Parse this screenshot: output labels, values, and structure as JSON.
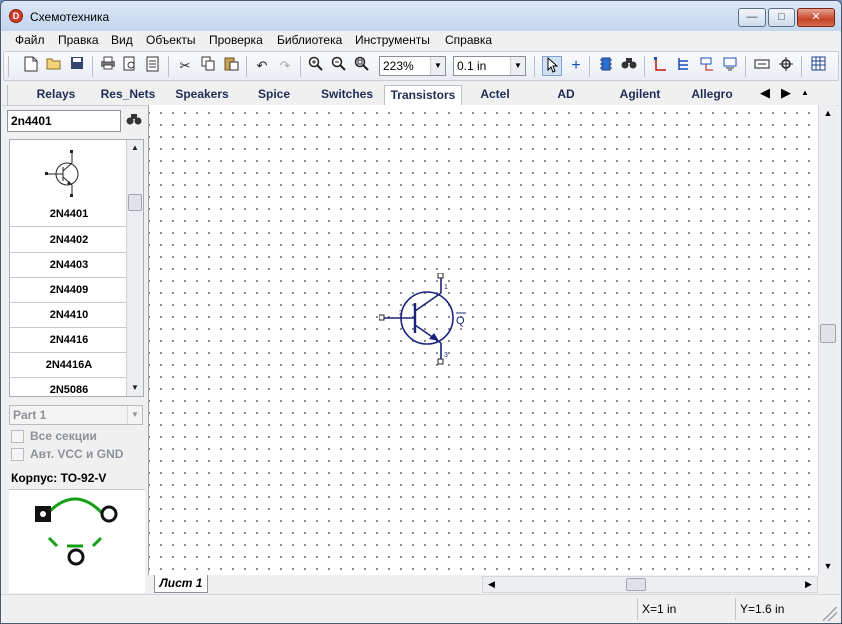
{
  "window": {
    "title": "Схемотехника"
  },
  "menu": [
    "Файл",
    "Правка",
    "Вид",
    "Объекты",
    "Проверка",
    "Библиотека",
    "Инструменты",
    "Справка"
  ],
  "toolbar": {
    "zoom": "223%",
    "grid": "0.1 in"
  },
  "library_tabs": [
    "Relays",
    "Res_Nets",
    "Speakers",
    "Spice",
    "Switches",
    "Transistors",
    "Actel",
    "AD",
    "Agilent",
    "Allegro"
  ],
  "active_library_tab": "Transistors",
  "search": {
    "value": "2n4401"
  },
  "parts": [
    "2N4401",
    "2N4402",
    "2N4403",
    "2N4409",
    "2N4410",
    "2N4416",
    "2N4416A",
    "2N5086"
  ],
  "part_selector": {
    "value": "Part 1"
  },
  "options": {
    "all_sections": "Все секции",
    "auto_vcc_gnd": "Авт. VCC и GND"
  },
  "package": {
    "label": "Корпус: TO-92-V"
  },
  "canvas": {
    "designator": "Q"
  },
  "sheet": {
    "tab": "Лист 1"
  },
  "status": {
    "x": "X=1 in",
    "y": "Y=1.6 in"
  },
  "colors": {
    "symbol": "#1a237e",
    "footprint_outline": "#12a012",
    "tab_text": "#1f2d55"
  }
}
